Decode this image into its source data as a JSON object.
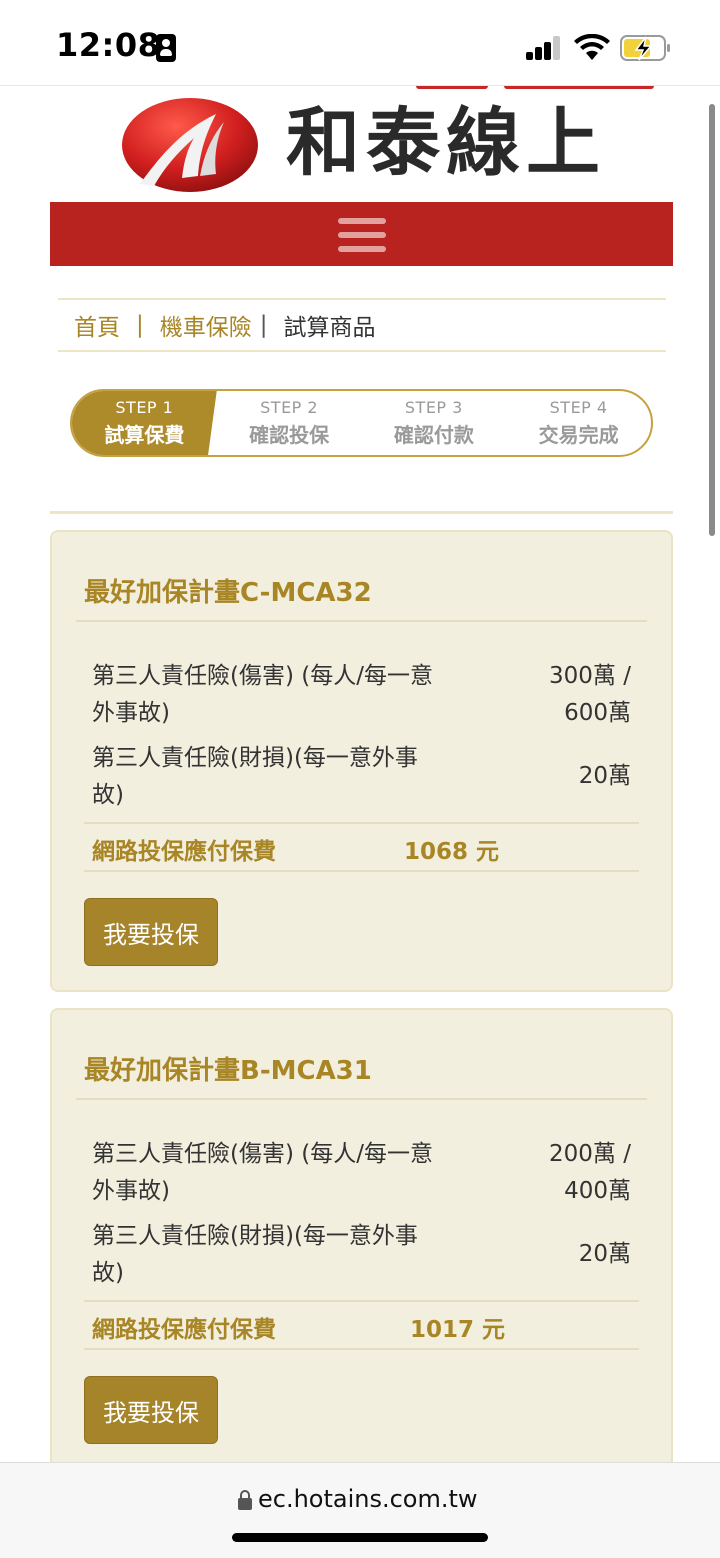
{
  "status_bar": {
    "time": "12:08",
    "icons": [
      "person-icon",
      "signal-icon",
      "wifi-icon",
      "battery-charging-icon"
    ]
  },
  "header": {
    "logo_text": "和泰線上",
    "brand_color": "#b8231f",
    "accent_color": "#a88525"
  },
  "breadcrumb": {
    "items": [
      "首頁",
      "機車保險",
      "試算商品"
    ]
  },
  "steps": [
    {
      "num": "STEP 1",
      "label": "試算保費",
      "active": true
    },
    {
      "num": "STEP 2",
      "label": "確認投保",
      "active": false
    },
    {
      "num": "STEP 3",
      "label": "確認付款",
      "active": false
    },
    {
      "num": "STEP 4",
      "label": "交易完成",
      "active": false
    }
  ],
  "plans": [
    {
      "title": "最好加保計畫C-MCA32",
      "coverages": [
        {
          "name_line1": "第三人責任險(傷害) (每人/每一意",
          "name_line2": "外事故)",
          "value_line1": "300萬 /",
          "value_line2": "600萬"
        },
        {
          "name_line1": "第三人責任險(財損)(每一意外事",
          "name_line2": "故)",
          "value_line1": "20萬",
          "value_line2": ""
        }
      ],
      "premium_label": "網路投保應付保費",
      "premium_value": "1068 元",
      "button_label": "我要投保"
    },
    {
      "title": "最好加保計畫B-MCA31",
      "coverages": [
        {
          "name_line1": "第三人責任險(傷害) (每人/每一意",
          "name_line2": "外事故)",
          "value_line1": "200萬 /",
          "value_line2": "400萬"
        },
        {
          "name_line1": "第三人責任險(財損)(每一意外事",
          "name_line2": "故)",
          "value_line1": "20萬",
          "value_line2": ""
        }
      ],
      "premium_label": "網路投保應付保費",
      "premium_value": "1017 元",
      "button_label": "我要投保"
    }
  ],
  "url_bar": {
    "url": "ec.hotains.com.tw"
  }
}
